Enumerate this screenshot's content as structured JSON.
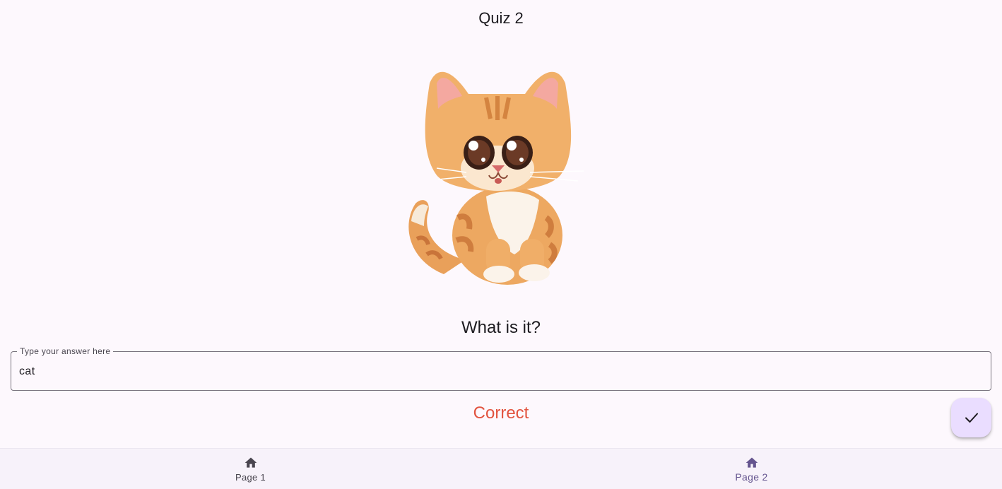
{
  "app": {
    "title": "Quiz 2"
  },
  "quiz": {
    "image_subject": "cartoon orange kitten",
    "question": "What is it?",
    "answer_field": {
      "label": "Type your answer here",
      "value": "cat"
    },
    "result": "Correct"
  },
  "fab": {
    "icon": "check-icon"
  },
  "bottom_nav": {
    "items": [
      {
        "label": "Page 1",
        "icon": "home-icon",
        "active": false
      },
      {
        "label": "Page 2",
        "icon": "home-icon",
        "active": true
      }
    ]
  },
  "colors": {
    "background": "#fdf8fd",
    "result_text": "#e2533f",
    "fab_bg": "#eaddff",
    "nav_active": "#65558f",
    "nav_inactive": "#49454f",
    "nav_bg": "#f7f2fa"
  }
}
